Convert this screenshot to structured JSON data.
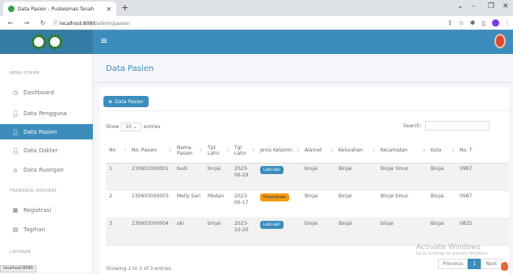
{
  "browser": {
    "tab_title": "Data Pasien - Puskesmas Tanah",
    "url_host": "localhost:8080",
    "url_path": "/admin/pasien",
    "status_url": "localhost:8080"
  },
  "sidebar": {
    "headers": [
      "MENU UTAMA",
      "TRANSAKSI BEROBAT",
      "LAPORAN"
    ],
    "items": [
      {
        "label": "Dashboard",
        "icon": "dashboard-icon"
      },
      {
        "label": "Data Pengguna",
        "icon": "user-icon"
      },
      {
        "label": "Data Pasien",
        "icon": "user-icon",
        "active": true
      },
      {
        "label": "Data Dokter",
        "icon": "user-icon"
      },
      {
        "label": "Data Ruangan",
        "icon": "home-icon"
      },
      {
        "label": "Registrasi",
        "icon": "calendar-icon"
      },
      {
        "label": "Tagihan",
        "icon": "receipt-icon"
      }
    ]
  },
  "main": {
    "title": "Data Pasien",
    "add_button": "Data Pasien",
    "show_label": "Show",
    "show_value": "10",
    "entries_label": "entries",
    "search_label": "Search:",
    "columns": [
      "No",
      "No. Pasien",
      "Nama Pasien",
      "Tpt Lahir",
      "Tgl Lahir",
      "Jenis Kelamin",
      "Alamat",
      "Kelurahan",
      "Kecamatan",
      "Kota",
      "No. T"
    ],
    "rows": [
      {
        "no": "1",
        "no_pasien": "230601000001",
        "nama": "budi",
        "tpt": "binjai",
        "tgl": "2023-06-29",
        "jk": "Laki-laki",
        "alamat": "binjai",
        "kelurahan": "Binjai",
        "kecamatan": "Binjai timur",
        "kota": "Binjai",
        "telp": "0987"
      },
      {
        "no": "2",
        "no_pasien": "230603000003",
        "nama": "Melly Sari",
        "tpt": "Medan",
        "tgl": "2023-06-17",
        "jk": "Perempuan",
        "alamat": "Binjai",
        "kelurahan": "Binjai",
        "kecamatan": "Binjai timur",
        "kota": "Binjai",
        "telp": "0987"
      },
      {
        "no": "3",
        "no_pasien": "230603000004",
        "nama": "oki",
        "tpt": "binjai",
        "tgl": "2023-10-20",
        "jk": "Laki-laki",
        "alamat": "binjai",
        "kelurahan": "Binjai",
        "kecamatan": "binjai",
        "kota": "Binjai",
        "telp": "0825"
      }
    ],
    "info": "Showing 1 to 3 of 3 entries",
    "pager": {
      "prev": "Previous",
      "page": "1",
      "next": "Next"
    },
    "watermark_title": "Activate Windows",
    "watermark_sub": "Go to Settings to activate Windows."
  }
}
